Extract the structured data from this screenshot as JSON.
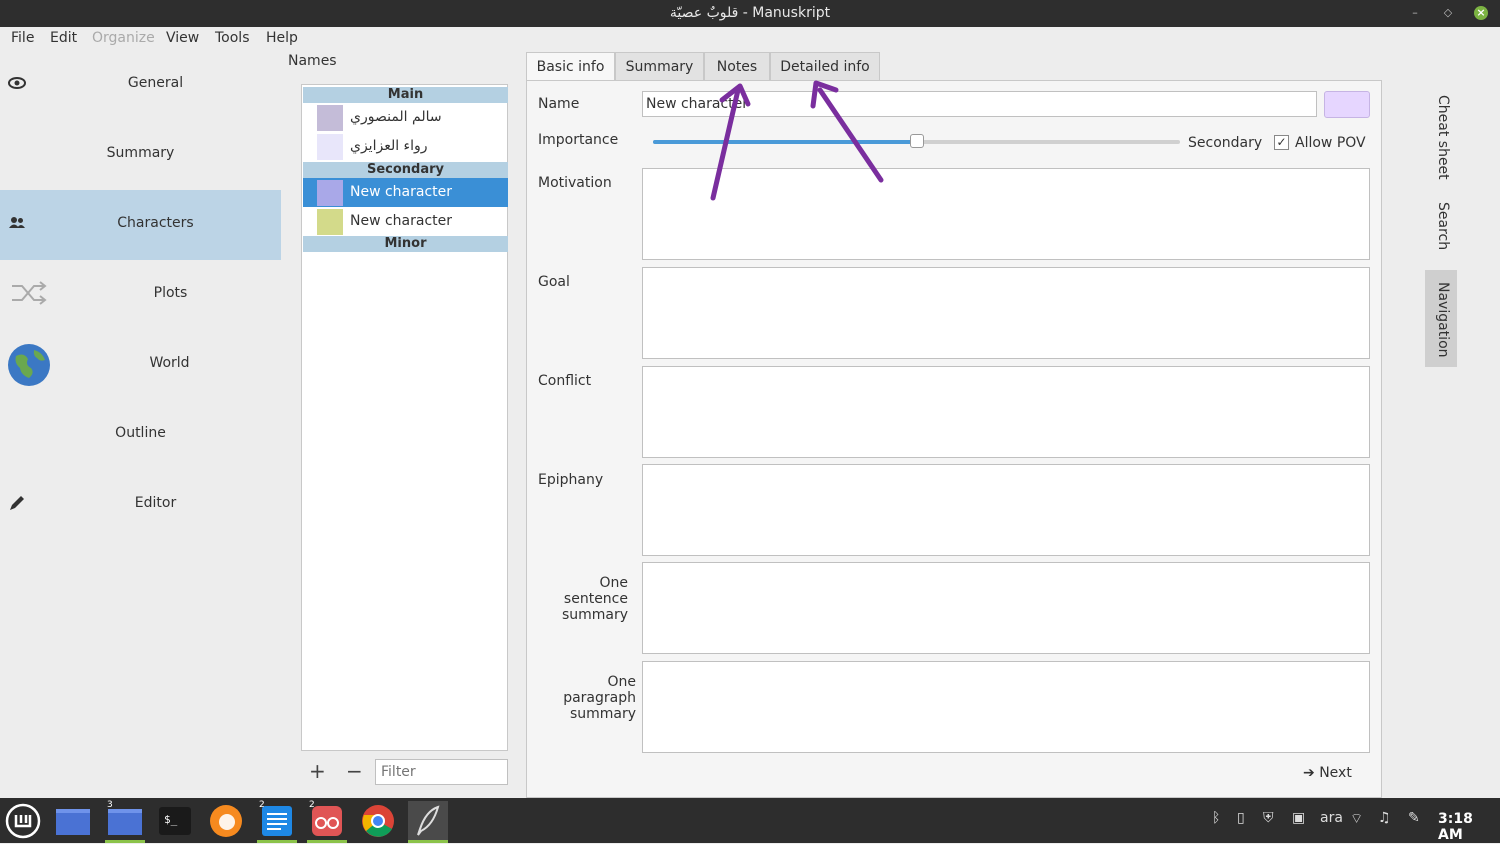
{
  "window": {
    "title": "قلوبٌ عصيّة - Manuskript"
  },
  "menubar": {
    "file": "File",
    "edit": "Edit",
    "organize": "Organize",
    "view": "View",
    "tools": "Tools",
    "help": "Help"
  },
  "nav": {
    "general": "General",
    "summary": "Summary",
    "characters": "Characters",
    "plots": "Plots",
    "world": "World",
    "outline": "Outline",
    "editor": "Editor"
  },
  "names": {
    "label": "Names",
    "groups": {
      "main": "Main",
      "secondary": "Secondary",
      "minor": "Minor"
    },
    "characters": [
      {
        "name": "سالم المنصوري",
        "color": "#c4bcd8"
      },
      {
        "name": "رواء العزايزي",
        "color": "#e8e6fa"
      },
      {
        "name": "New character",
        "color": "#a9a8e8",
        "selected": true
      },
      {
        "name": "New character",
        "color": "#d3da8a"
      }
    ],
    "add": "+",
    "remove": "−",
    "filter_placeholder": "Filter"
  },
  "tabs": {
    "basic": "Basic info",
    "summary": "Summary",
    "notes": "Notes",
    "detailed": "Detailed info"
  },
  "form": {
    "name_label": "Name",
    "name_value": "New character",
    "character_color": "#e6d6ff",
    "importance_label": "Importance",
    "importance_level": 0.5,
    "importance_value": "Secondary",
    "allow_pov_label": "Allow POV",
    "allow_pov_checked": true,
    "motivation": "Motivation",
    "goal": "Goal",
    "conflict": "Conflict",
    "epiphany": "Epiphany",
    "one_sentence": [
      "One sentence",
      "summary"
    ],
    "one_paragraph": [
      "One paragraph",
      "summary"
    ],
    "next": "Next"
  },
  "dock": {
    "cheat": "Cheat sheet",
    "search": "Search",
    "navigation": "Navigation"
  },
  "taskbar": {
    "clock": "3:18 AM",
    "lang": "ara",
    "badge_files": "3",
    "badge_editor": "2",
    "badge_reader": "2"
  },
  "annotation_color": "#7a2e9e"
}
